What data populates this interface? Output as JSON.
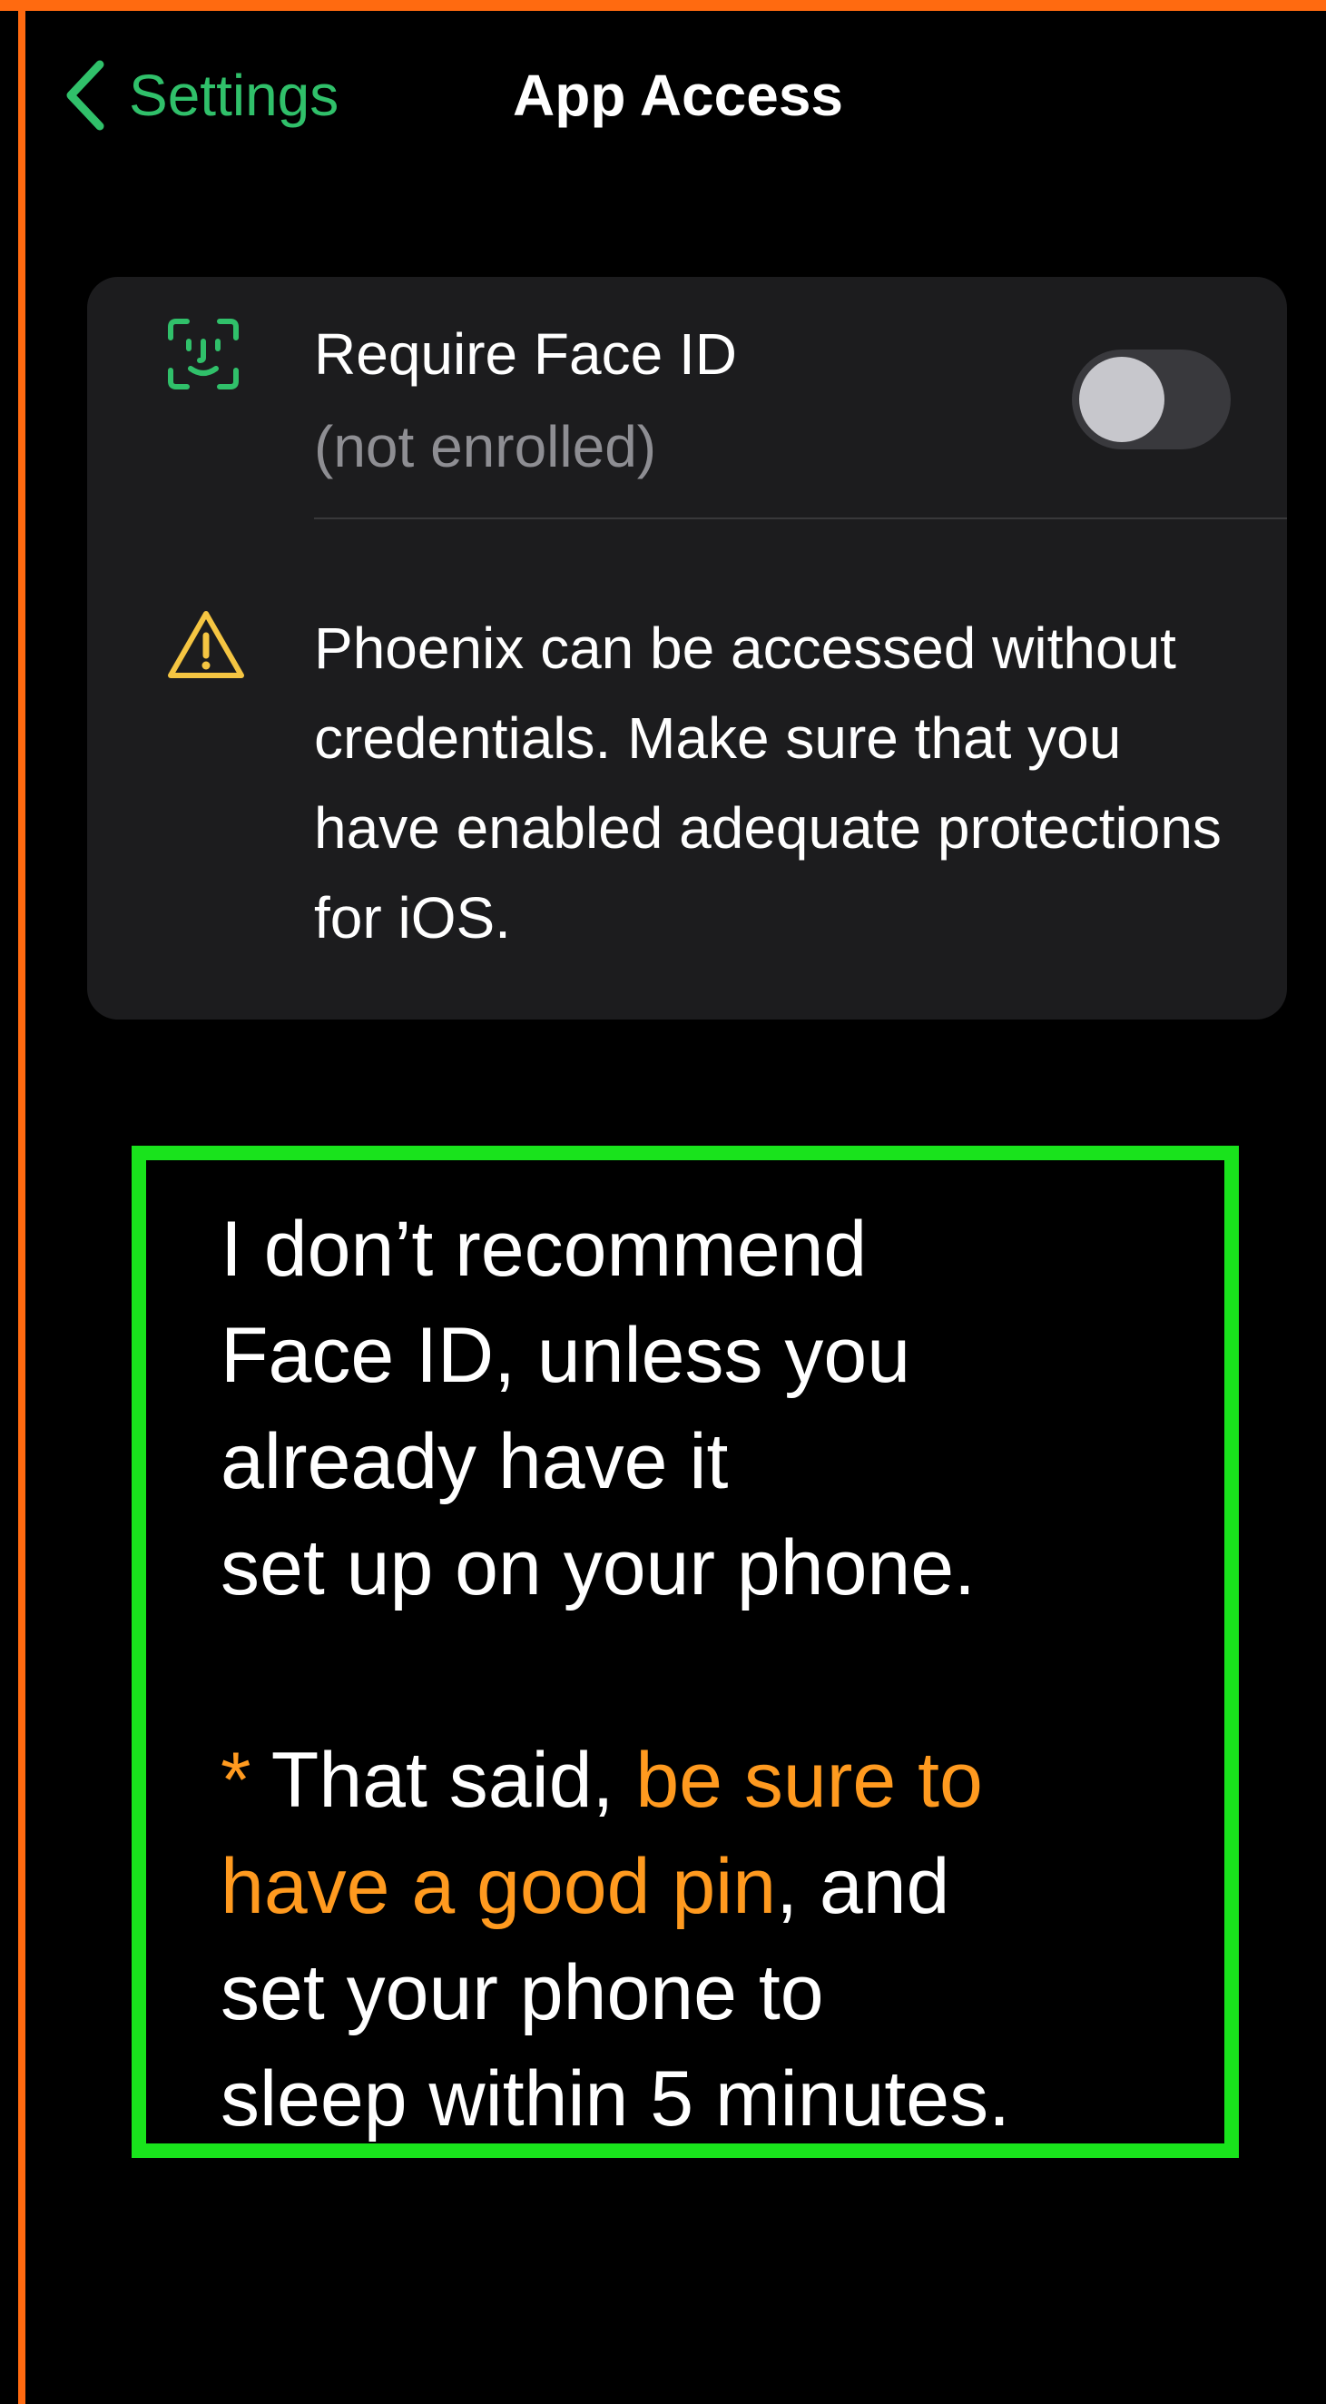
{
  "nav": {
    "back_label": "Settings",
    "title": "App Access"
  },
  "face_id": {
    "title": "Require Face ID",
    "subtitle": "(not enrolled)",
    "toggle_on": false
  },
  "warning": {
    "text": "Phoenix can be accessed without credentials. Make sure that you have enabled adequate protections for iOS."
  },
  "annotation": {
    "para1_lines": [
      "I don’t recommend",
      "Face ID, unless you",
      "already have it",
      "set up on your phone."
    ],
    "para2": {
      "asterisk": "*",
      "text_a": " That said, ",
      "highlight_a": "be sure to",
      "highlight_b": "have a good pin",
      "text_b": ", and",
      "line3": "set your phone to",
      "line4": "sleep within 5 minutes."
    }
  },
  "colors": {
    "accent_green": "#30c06a",
    "warning_yellow": "#f5c542",
    "annotation_border": "#19e31c",
    "highlight_orange": "#ff9a1f",
    "frame_orange": "#ff6a10"
  }
}
